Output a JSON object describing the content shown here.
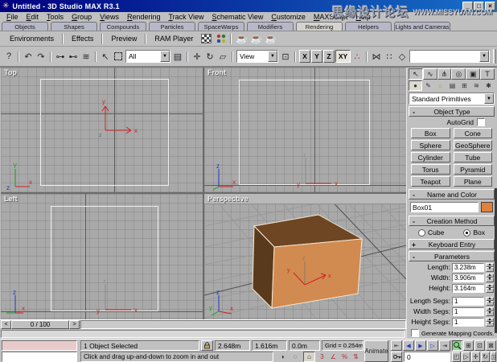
{
  "window": {
    "title": "Untitled - 3D Studio MAX R3.1",
    "watermark_text": "思缘设计论坛",
    "watermark_url": "WWW.MISSYUAN.COM"
  },
  "menu": {
    "items": [
      "File",
      "Edit",
      "Tools",
      "Group",
      "Views",
      "Rendering",
      "Track View",
      "Schematic View",
      "Customize",
      "MAXScript",
      "Help"
    ]
  },
  "tabbar": {
    "tabs": [
      "Objects",
      "Shapes",
      "Compounds",
      "Particles",
      "SpaceWarps",
      "Modifiers",
      "Rendering",
      "Helpers",
      "Lights and Cameras"
    ],
    "active": "Rendering"
  },
  "render_toolbar": {
    "environments": "Environments",
    "effects": "Effects",
    "preview": "Preview",
    "ram_player": "RAM Player"
  },
  "main_toolbar": {
    "selection_filter": "All",
    "coord_system": "View",
    "axis_x": "X",
    "axis_y": "Y",
    "axis_z": "Z",
    "axis_xy": "XY",
    "active_axis": "XY",
    "named_selection": ""
  },
  "viewports": {
    "top_label": "Top",
    "front_label": "Front",
    "left_label": "Left",
    "perspective_label": "Perspective"
  },
  "command_panel": {
    "category": "Standard Primitives",
    "object_type": {
      "title": "Object Type",
      "autogrid": "AutoGrid",
      "buttons": [
        "Box",
        "Cone",
        "Sphere",
        "GeoSphere",
        "Cylinder",
        "Tube",
        "Torus",
        "Pyramid",
        "Teapot",
        "Plane"
      ]
    },
    "name_color": {
      "title": "Name and Color",
      "name": "Box01",
      "color": "#e0813c"
    },
    "creation_method": {
      "title": "Creation Method",
      "cube": "Cube",
      "box": "Box",
      "selected": "Box"
    },
    "keyboard_entry": {
      "title": "Keyboard Entry"
    },
    "parameters": {
      "title": "Parameters",
      "fields": [
        {
          "label": "Length:",
          "value": "3.238m"
        },
        {
          "label": "Width:",
          "value": "3.906m"
        },
        {
          "label": "Height:",
          "value": "3.164m"
        },
        {
          "label": "Length Segs:",
          "value": "1"
        },
        {
          "label": "Width Segs:",
          "value": "1"
        },
        {
          "label": "Height Segs:",
          "value": "1"
        }
      ],
      "mapping": "Generate Mapping Coords."
    }
  },
  "time": {
    "slider": "0 / 100",
    "frame": "0",
    "left_arrow": "<",
    "right_arrow": ">"
  },
  "status": {
    "selection": "1 Object Selected",
    "x": "2.648m",
    "y": "1.616m",
    "z": "0.0m",
    "grid": "Grid = 0.254m",
    "prompt": "Click and drag up-and-down to zoom in and out",
    "animate": "Animate"
  },
  "icons": {
    "logo": "✳",
    "minimize": "_",
    "maximize": "□",
    "close": "×",
    "context_help": "?",
    "undo": "↶",
    "redo": "↷",
    "select_link": "⊶",
    "unlink": "⊷",
    "bind_spacewarp": "≋",
    "select_object": "↖",
    "select_by_name": "▤",
    "move": "✛",
    "rotate": "↻",
    "scale": "▱",
    "use_center": "⊡",
    "ik_toggle": "∴",
    "mirror": "⋈",
    "array": "∷",
    "align": "◇",
    "dropdown_arrow": "▼",
    "render_scene": "☕",
    "quick_render": "☕",
    "render_last": "☕",
    "cp_create": "↖",
    "cp_modify": "∿",
    "cp_hierarchy": "⋔",
    "cp_motion": "◎",
    "cp_display": "▣",
    "cp_utilities": "T",
    "sub_geometry": "●",
    "sub_shapes": "✎",
    "sub_lights": "☼",
    "sub_cameras": "▤",
    "sub_helpers": "⊞",
    "sub_spacewarps": "≋",
    "sub_systems": "✱",
    "rollout_open": "-",
    "rollout_closed": "+",
    "degradation": "◑",
    "crossing": "◌",
    "snap_home": "⌂",
    "snap_3d": "3",
    "angle_snap": "∠",
    "percent_snap": "%",
    "spinner_snap": "⇅",
    "go_start": "⇤",
    "prev_frame": "◀",
    "play": "▶",
    "next_frame": "▷",
    "go_end": "⇥",
    "zoom_all": "⊞",
    "zoom_extents": "⊡",
    "zoom_extents_all": "⊠",
    "region_zoom": "◰",
    "fov": "▷",
    "pan": "✛",
    "arc_rotate": "↻",
    "minmax": "◳"
  },
  "colors": {
    "titlebar_start": "#000080",
    "titlebar_end": "#1670c8",
    "viewport_bg": "#a9a9a9",
    "box_top": "#6e4623",
    "box_left": "#5a3a1c",
    "box_front": "#d18a50",
    "object_color": "#e0813c",
    "zoom_active_bg": "#8fd08f"
  }
}
